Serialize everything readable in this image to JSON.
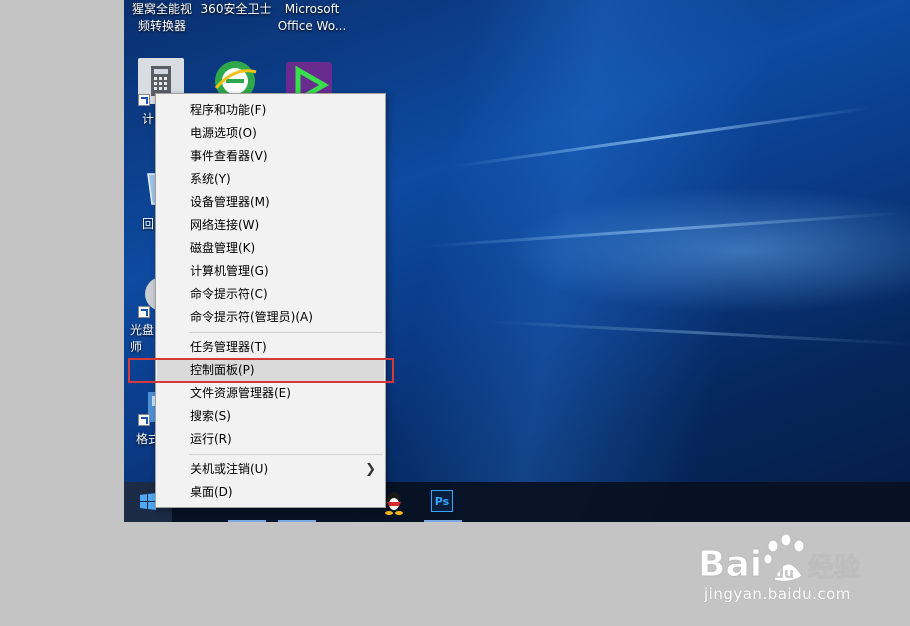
{
  "desktop": {
    "top_icons": [
      {
        "label": "猩窝全能视\n频转换器"
      },
      {
        "label": "360安全卫士"
      },
      {
        "label": "Microsoft\nOffice Wo..."
      }
    ],
    "side_labels": [
      {
        "label": "计"
      },
      {
        "label": "回"
      },
      {
        "label": "光盘\n师"
      },
      {
        "label": "格式"
      }
    ]
  },
  "context_menu": {
    "items": [
      {
        "label": "程序和功能(F)"
      },
      {
        "label": "电源选项(O)"
      },
      {
        "label": "事件查看器(V)"
      },
      {
        "label": "系统(Y)"
      },
      {
        "label": "设备管理器(M)"
      },
      {
        "label": "网络连接(W)"
      },
      {
        "label": "磁盘管理(K)"
      },
      {
        "label": "计算机管理(G)"
      },
      {
        "label": "命令提示符(C)"
      },
      {
        "label": "命令提示符(管理员)(A)"
      },
      {
        "label": "任务管理器(T)"
      },
      {
        "label": "控制面板(P)"
      },
      {
        "label": "文件资源管理器(E)"
      },
      {
        "label": "搜索(S)"
      },
      {
        "label": "运行(R)"
      },
      {
        "label": "关机或注销(U)"
      },
      {
        "label": "桌面(D)"
      }
    ],
    "highlighted_item": "控制面板(P)"
  },
  "taskbar": {
    "apps": [
      {
        "icon": "qq-icon"
      },
      {
        "icon": "photoshop-icon",
        "label": "Ps"
      }
    ]
  },
  "watermark": {
    "brand": "Bai",
    "du": "du",
    "jingyan": "经验",
    "url": "jingyan.baidu.com"
  },
  "colors": {
    "highlight_border": "#d43a3a",
    "menu_bg": "#f2f2f2",
    "menu_hover": "#dadada"
  }
}
